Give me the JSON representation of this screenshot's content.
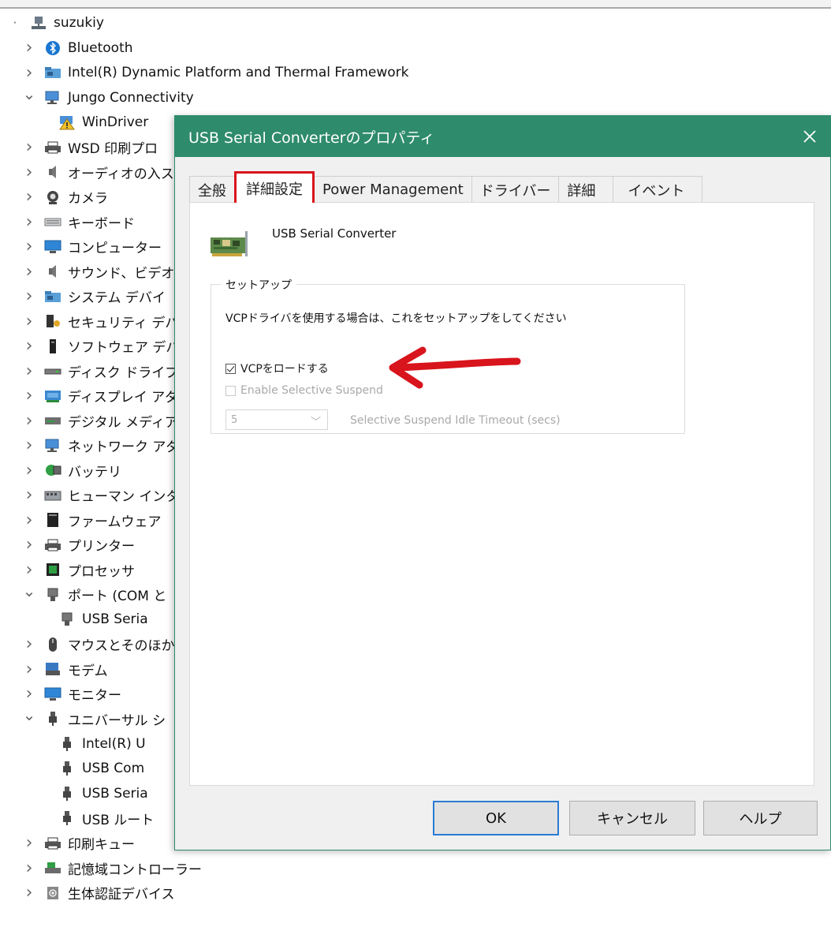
{
  "tree": {
    "items": [
      {
        "label": "suzukiy",
        "icon": "computer-network-icon",
        "chevron": "none"
      },
      {
        "label": "Bluetooth",
        "icon": "bluetooth-icon",
        "chevron": "collapsed"
      },
      {
        "label": "Intel(R) Dynamic Platform and Thermal Framework",
        "icon": "device-folder-icon",
        "chevron": "collapsed"
      },
      {
        "label": "Jungo Connectivity",
        "icon": "network-monitor-icon",
        "chevron": "expanded"
      },
      {
        "label": "WinDriver",
        "icon": "warning-device-icon",
        "chevron": "none"
      },
      {
        "label": "WSD 印刷プロ",
        "icon": "printer-icon",
        "chevron": "collapsed"
      },
      {
        "label": "オーディオの入ス",
        "icon": "speaker-icon",
        "chevron": "collapsed"
      },
      {
        "label": "カメラ",
        "icon": "camera-icon",
        "chevron": "collapsed"
      },
      {
        "label": "キーボード",
        "icon": "keyboard-icon",
        "chevron": "collapsed"
      },
      {
        "label": "コンピューター",
        "icon": "monitor-icon",
        "chevron": "collapsed"
      },
      {
        "label": "サウンド、ビデオ",
        "icon": "speaker-icon",
        "chevron": "collapsed"
      },
      {
        "label": "システム デバイ",
        "icon": "device-folder-icon",
        "chevron": "collapsed"
      },
      {
        "label": "セキュリティ デバ",
        "icon": "security-key-icon",
        "chevron": "collapsed"
      },
      {
        "label": "ソフトウェア デバ",
        "icon": "tower-icon",
        "chevron": "collapsed"
      },
      {
        "label": "ディスク ドライブ",
        "icon": "disk-drive-icon",
        "chevron": "collapsed"
      },
      {
        "label": "ディスプレイ アダ",
        "icon": "display-adapter-icon",
        "chevron": "collapsed"
      },
      {
        "label": "デジタル メディア",
        "icon": "media-device-icon",
        "chevron": "collapsed"
      },
      {
        "label": "ネットワーク アダ",
        "icon": "network-monitor-icon",
        "chevron": "collapsed"
      },
      {
        "label": "バッテリ",
        "icon": "battery-icon",
        "chevron": "collapsed"
      },
      {
        "label": "ヒューマン インタ",
        "icon": "hid-icon",
        "chevron": "collapsed"
      },
      {
        "label": "ファームウェア",
        "icon": "firmware-icon",
        "chevron": "collapsed"
      },
      {
        "label": "プリンター",
        "icon": "printer-icon",
        "chevron": "collapsed"
      },
      {
        "label": "プロセッサ",
        "icon": "processor-icon",
        "chevron": "collapsed"
      },
      {
        "label": "ポート (COM と",
        "icon": "port-icon",
        "chevron": "expanded"
      },
      {
        "label": "USB Seria",
        "icon": "port-icon",
        "chevron": "none"
      },
      {
        "label": "マウスとそのほか",
        "icon": "mouse-icon",
        "chevron": "collapsed"
      },
      {
        "label": "モデム",
        "icon": "modem-icon",
        "chevron": "collapsed"
      },
      {
        "label": "モニター",
        "icon": "monitor-icon",
        "chevron": "collapsed"
      },
      {
        "label": "ユニバーサル シ",
        "icon": "usb-plug-icon",
        "chevron": "expanded"
      },
      {
        "label": "Intel(R) U",
        "icon": "usb-plug-icon",
        "chevron": "none"
      },
      {
        "label": "USB Com",
        "icon": "usb-plug-icon",
        "chevron": "none"
      },
      {
        "label": "USB Seria",
        "icon": "usb-plug-icon",
        "chevron": "none"
      },
      {
        "label": "USB ルート",
        "icon": "usb-plug-icon",
        "chevron": "none"
      },
      {
        "label": "印刷キュー",
        "icon": "printer-icon",
        "chevron": "collapsed"
      },
      {
        "label": "記憶域コントローラー",
        "icon": "storage-controller-icon",
        "chevron": "collapsed"
      },
      {
        "label": "生体認証デバイス",
        "icon": "biometric-icon",
        "chevron": "collapsed"
      }
    ]
  },
  "dialog": {
    "title": "USB Serial Converterのプロパティ",
    "close_glyph": "✕",
    "accent_color": "#2e8b6b",
    "highlight_color": "#d8141c",
    "tabs": [
      "全般",
      "詳細設定",
      "Power Management",
      "ドライバー",
      "詳細",
      "イベント"
    ],
    "active_tab": "詳細設定",
    "device_name": "USB Serial Converter",
    "device_icon": "pci-card-icon",
    "setup": {
      "legend": "セットアップ",
      "description": "VCPドライバを使用する場合は、これをセットアップをしてください",
      "load_vcp_label": "VCPをロードする",
      "load_vcp_checked": true,
      "selective_suspend_label": "Enable Selective Suspend",
      "selective_suspend_checked": false,
      "timeout_value": "5",
      "timeout_label": "Selective Suspend Idle Timeout (secs)"
    },
    "buttons": {
      "ok": "OK",
      "cancel": "キャンセル",
      "help": "ヘルプ"
    }
  }
}
